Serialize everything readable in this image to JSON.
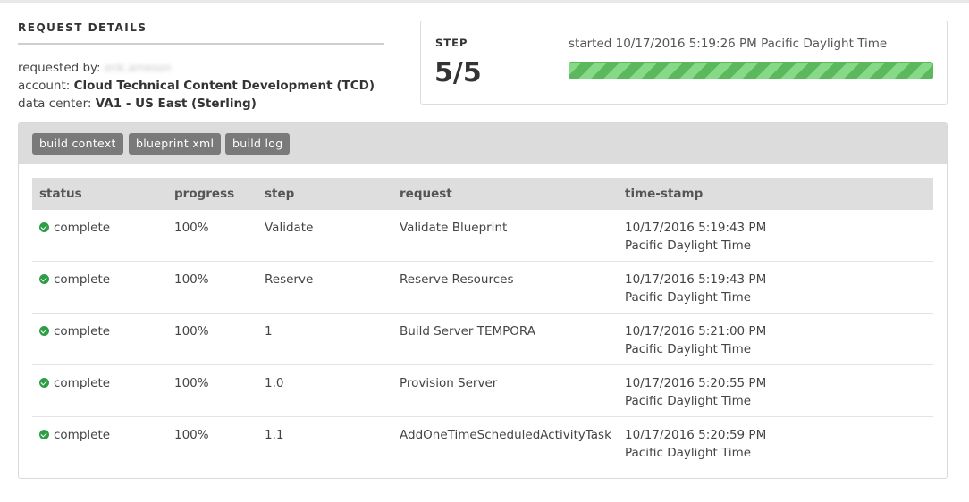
{
  "request_details": {
    "title": "REQUEST DETAILS",
    "requested_by_label": "requested by:",
    "requested_by_value": "erik.arneson",
    "account_label": "account:",
    "account_value": "Cloud Technical Content Development (TCD)",
    "datacenter_label": "data center:",
    "datacenter_value": "VA1 - US East (Sterling)"
  },
  "step": {
    "label": "STEP",
    "value": "5/5",
    "started": "started 10/17/2016 5:19:26 PM Pacific Daylight Time",
    "progress_fraction": 1.0,
    "progress_color": "#5cb85c"
  },
  "buttons": {
    "build_context": "build context",
    "blueprint_xml": "blueprint xml",
    "build_log": "build log"
  },
  "table": {
    "headers": [
      "status",
      "progress",
      "step",
      "request",
      "time-stamp"
    ],
    "rows": [
      {
        "status": "complete",
        "progress": "100%",
        "step": "Validate",
        "request": "Validate Blueprint",
        "time": "10/17/2016 5:19:43 PM",
        "tz": "Pacific Daylight Time"
      },
      {
        "status": "complete",
        "progress": "100%",
        "step": "Reserve",
        "request": "Reserve Resources",
        "time": "10/17/2016 5:19:43 PM",
        "tz": "Pacific Daylight Time"
      },
      {
        "status": "complete",
        "progress": "100%",
        "step": "1",
        "request": "Build Server TEMPORA",
        "time": "10/17/2016 5:21:00 PM",
        "tz": "Pacific Daylight Time"
      },
      {
        "status": "complete",
        "progress": "100%",
        "step": "1.0",
        "request": "Provision Server",
        "time": "10/17/2016 5:20:55 PM",
        "tz": "Pacific Daylight Time"
      },
      {
        "status": "complete",
        "progress": "100%",
        "step": "1.1",
        "request": "AddOneTimeScheduledActivityTask",
        "time": "10/17/2016 5:20:59 PM",
        "tz": "Pacific Daylight Time"
      }
    ]
  },
  "colors": {
    "status_ok": "#2e9d46",
    "button_bg": "#7a7a7a",
    "header_bg": "#dedede"
  }
}
